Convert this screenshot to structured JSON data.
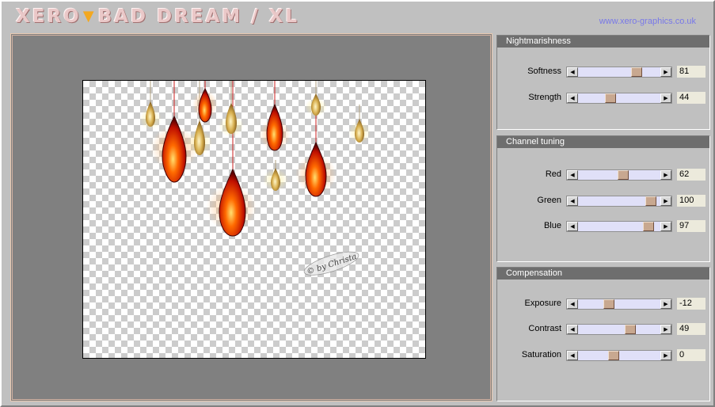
{
  "header": {
    "logo_left": "XERO",
    "logo_right": "BAD DREAM / XL",
    "website": "www.xero-graphics.co.uk"
  },
  "preview": {
    "watermark": "© by Christa",
    "drop_colors": {
      "red": "#cc1a00",
      "gold": "#c89a3c"
    }
  },
  "panels": [
    {
      "title": "Nightmarishness",
      "controls": [
        {
          "label": "Softness",
          "value": "81",
          "min": 0,
          "max": 100
        },
        {
          "label": "Strength",
          "value": "44",
          "min": 0,
          "max": 100
        }
      ]
    },
    {
      "title": "Channel tuning",
      "controls": [
        {
          "label": "Red",
          "value": "62",
          "min": 0,
          "max": 100
        },
        {
          "label": "Green",
          "value": "100",
          "min": 0,
          "max": 100
        },
        {
          "label": "Blue",
          "value": "97",
          "min": 0,
          "max": 100
        }
      ]
    },
    {
      "title": "Compensation",
      "controls": [
        {
          "label": "Exposure",
          "value": "-12",
          "min": -100,
          "max": 100
        },
        {
          "label": "Contrast",
          "value": "49",
          "min": -100,
          "max": 100
        },
        {
          "label": "Saturation",
          "value": "0",
          "min": -100,
          "max": 100
        }
      ]
    }
  ]
}
